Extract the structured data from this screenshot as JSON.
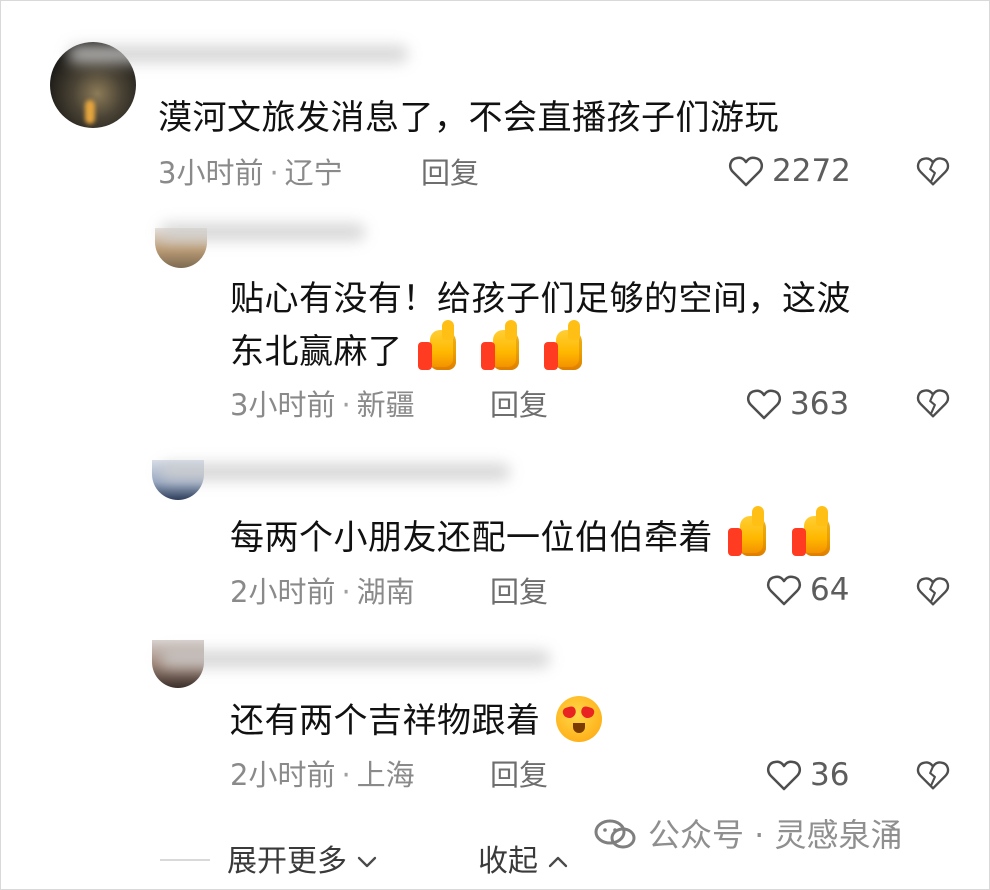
{
  "comments": [
    {
      "text": "漠河文旅发消息了，不会直播孩子们游玩",
      "time": "3小时前",
      "location": "辽宁",
      "reply_label": "回复",
      "likes": "2272"
    },
    {
      "text_line1": "贴心有没有！给孩子们足够的空间，这波",
      "text_line2": "东北赢麻了",
      "time": "3小时前",
      "location": "新疆",
      "reply_label": "回复",
      "likes": "363"
    },
    {
      "text": "每两个小朋友还配一位伯伯牵着",
      "time": "2小时前",
      "location": "湖南",
      "reply_label": "回复",
      "likes": "64"
    },
    {
      "text": "还有两个吉祥物跟着",
      "time": "2小时前",
      "location": "上海",
      "reply_label": "回复",
      "likes": "36"
    }
  ],
  "footer": {
    "expand_more": "展开更多",
    "collapse": "收起"
  },
  "watermark": {
    "text": "公众号 · 灵感泉涌"
  },
  "icons": {
    "like": "heart-outline-icon",
    "dislike": "broken-heart-icon",
    "chevron_down": "chevron-down-icon",
    "chevron_up": "chevron-up-icon",
    "wechat": "wechat-icon",
    "thumbs_up": "thumbs-up-emoji-icon",
    "heart_eyes": "heart-eyes-emoji-icon"
  },
  "colors": {
    "text": "#111111",
    "meta": "#8a8a8a",
    "icon": "#4e4e4e",
    "emoji_thumb": "#ffb800",
    "emoji_red": "#ff3b21"
  }
}
